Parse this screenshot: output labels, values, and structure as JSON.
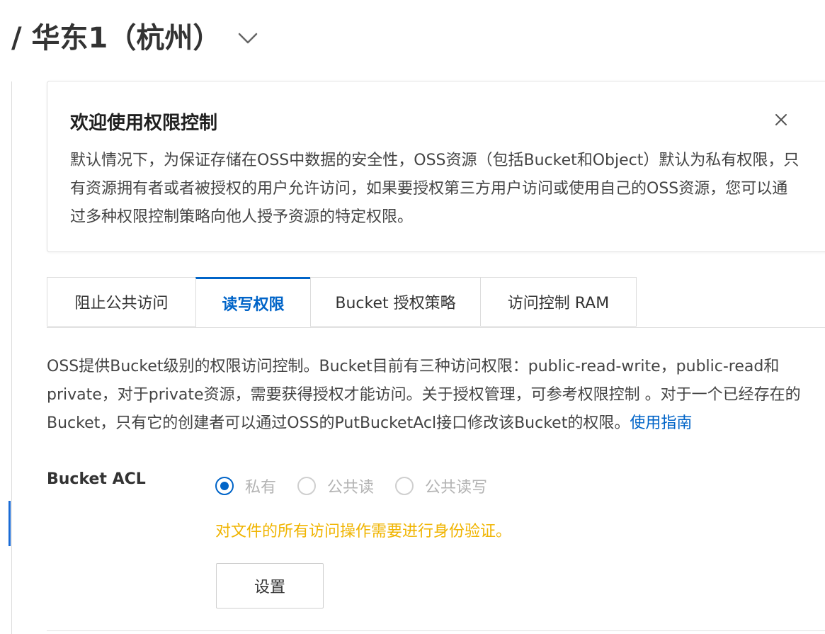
{
  "header": {
    "region_title": "/ 华东1（杭州）",
    "chevron_icon": "chevron-down-icon"
  },
  "notice": {
    "title": "欢迎使用权限控制",
    "close_icon": "close-icon",
    "body": "默认情况下，为保证存储在OSS中数据的安全性，OSS资源（包括Bucket和Object）默认为私有权限，只有资源拥有者或者被授权的用户允许访问，如果要授权第三方用户访问或使用自己的OSS资源，您可以通过多种权限控制策略向他人授予资源的特定权限。"
  },
  "tabs": [
    {
      "label": "阻止公共访问",
      "active": false
    },
    {
      "label": "读写权限",
      "active": true
    },
    {
      "label": "Bucket 授权策略",
      "active": false
    },
    {
      "label": "访问控制 RAM",
      "active": false
    }
  ],
  "description": {
    "text": "OSS提供Bucket级别的权限访问控制。Bucket目前有三种访问权限：public-read-write，public-read和private，对于private资源，需要获得授权才能访问。关于授权管理，可参考权限控制 。对于一个已经存在的Bucket，只有它的创建者可以通过OSS的PutBucketAcl接口修改该Bucket的权限。",
    "link": "使用指南"
  },
  "acl": {
    "label": "Bucket ACL",
    "options": [
      {
        "label": "私有",
        "checked": true
      },
      {
        "label": "公共读",
        "checked": false
      },
      {
        "label": "公共读写",
        "checked": false
      }
    ],
    "hint": "对文件的所有访问操作需要进行身份验证。",
    "button": "设置"
  },
  "colors": {
    "accent": "#0064c8",
    "warning": "#f0b400"
  }
}
